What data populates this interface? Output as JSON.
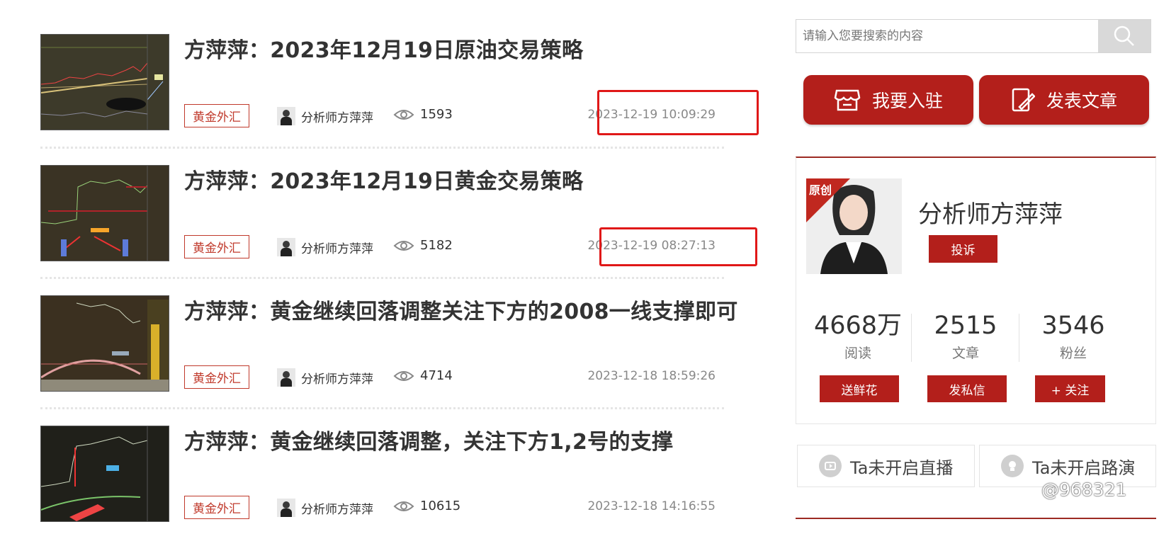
{
  "search": {
    "placeholder": "请输入您要搜索的内容"
  },
  "actions": {
    "join_label": "我要入驻",
    "publish_label": "发表文章"
  },
  "articles": [
    {
      "title": "方萍萍：2023年12月19日原油交易策略",
      "tag": "黄金外汇",
      "author": "分析师方萍萍",
      "views": "1593",
      "date": "2023-12-19 10:09:29"
    },
    {
      "title": "方萍萍：2023年12月19日黄金交易策略",
      "tag": "黄金外汇",
      "author": "分析师方萍萍",
      "views": "5182",
      "date": "2023-12-19 08:27:13"
    },
    {
      "title": "方萍萍：黄金继续回落调整关注下方的2008一线支撑即可",
      "tag": "黄金外汇",
      "author": "分析师方萍萍",
      "views": "4714",
      "date": "2023-12-18 18:59:26"
    },
    {
      "title": "方萍萍：黄金继续回落调整，关注下方1,2号的支撑",
      "tag": "黄金外汇",
      "author": "分析师方萍萍",
      "views": "10615",
      "date": "2023-12-18 14:16:55"
    }
  ],
  "profile": {
    "badge": "原创",
    "name": "分析师方萍萍",
    "complaint_label": "投诉",
    "stats": [
      {
        "value": "4668万",
        "label": "阅读"
      },
      {
        "value": "2515",
        "label": "文章"
      },
      {
        "value": "3546",
        "label": "粉丝"
      }
    ],
    "buttons": {
      "flower": "送鲜花",
      "message": "发私信",
      "follow": "+ 关注"
    }
  },
  "live": {
    "stream_label": "Ta未开启直播",
    "roadshow_label": "Ta未开启路演"
  },
  "watermark": "@968321",
  "colors": {
    "brand_red": "#b31f1b",
    "tag_red": "#c0392b",
    "highlight_box": "#e01818"
  }
}
